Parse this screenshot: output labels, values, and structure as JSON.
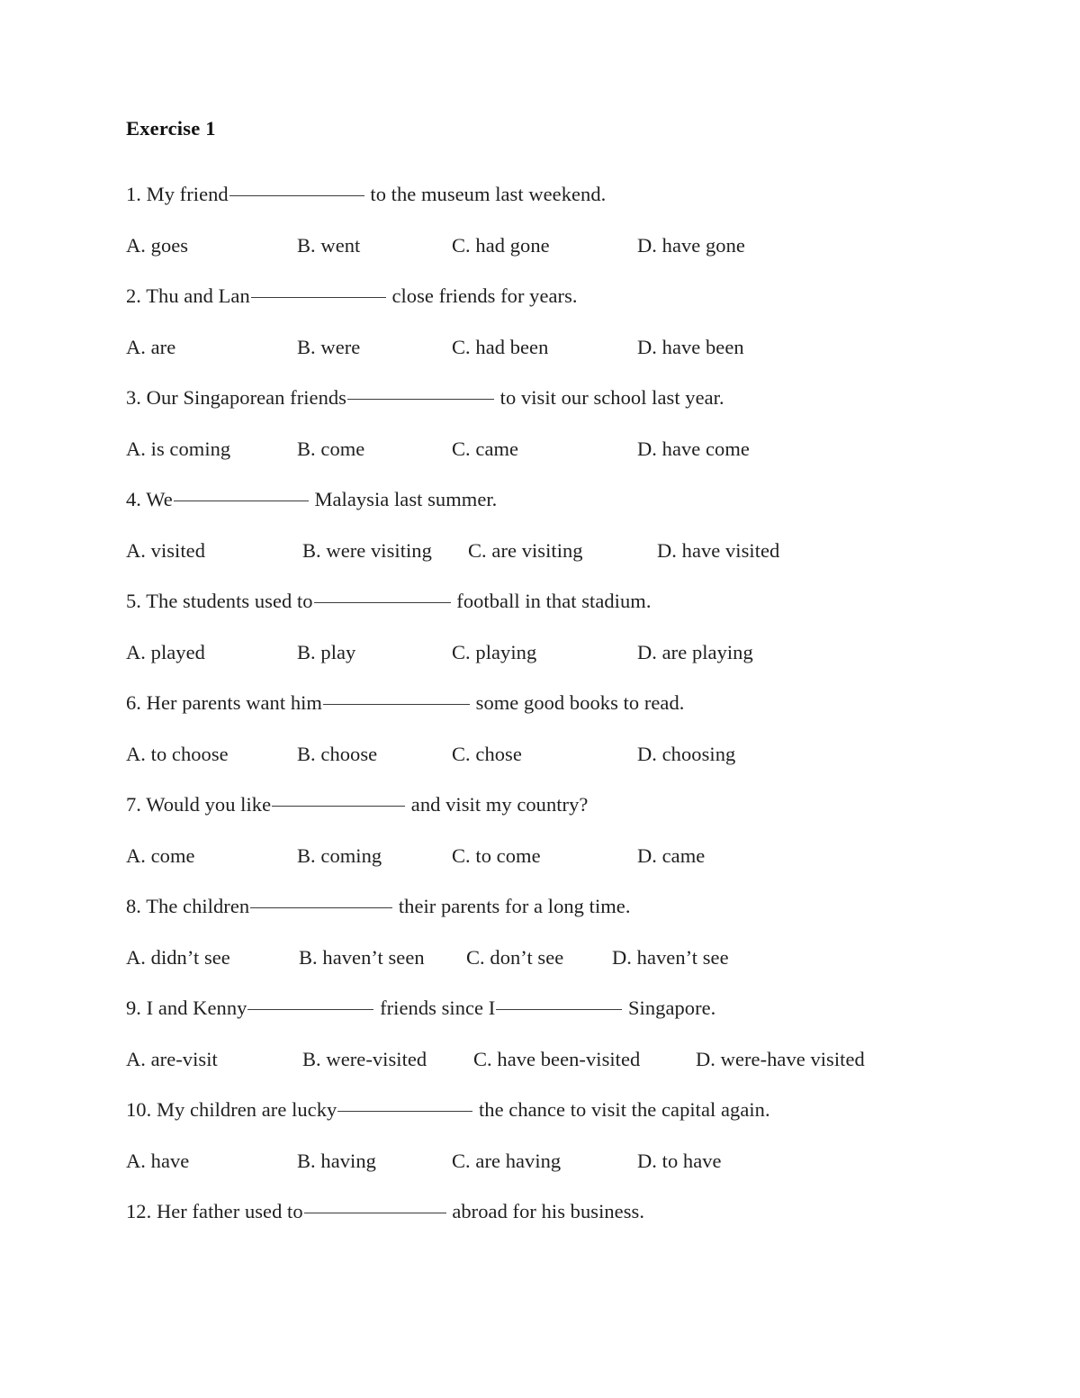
{
  "document": {
    "title": "Exercise 1",
    "items": [
      {
        "type": "question",
        "number": "1.",
        "text_before": "1. My friend",
        "blank_1_width": 150,
        "text_after": " to the museum last weekend.",
        "full_text": "1. My friend_____________ to the museum last weekend."
      },
      {
        "type": "options",
        "layout": "standard",
        "a": "A. goes",
        "b": "B. went",
        "c": "C. had gone",
        "d": "D. have gone"
      },
      {
        "type": "question",
        "number": "2.",
        "text_before": "2. Thu and Lan",
        "blank_1_width": 150,
        "text_after": " close friends for years.",
        "full_text": "2. Thu and Lan_____________ close friends for years."
      },
      {
        "type": "options",
        "layout": "standard",
        "a": "A. are",
        "b": "B. were",
        "c": "C. had been",
        "d": "D. have been"
      },
      {
        "type": "question",
        "number": "3.",
        "text_before": "3. Our Singaporean friends",
        "blank_1_width": 163,
        "text_after": " to visit our school last year.",
        "full_text": "3. Our Singaporean friends_______________ to visit our school last year."
      },
      {
        "type": "options",
        "layout": "standard",
        "a": "A. is coming",
        "b": "B. come",
        "c": "C. came",
        "d": "D. have come"
      },
      {
        "type": "question",
        "number": "4.",
        "text_before": "4. We",
        "blank_1_width": 150,
        "text_after": " Malaysia last summer.",
        "full_text": "4. We_____________ Malaysia last summer."
      },
      {
        "type": "options",
        "layout": "wide",
        "a": "A. visited",
        "b": "B. were visiting",
        "c": "C. are visiting",
        "d": "D. have visited"
      },
      {
        "type": "question",
        "number": "5.",
        "text_before": "5. The students used to",
        "blank_1_width": 152,
        "text_after": " football in that stadium.",
        "full_text": "5. The students used to______________ football in that stadium."
      },
      {
        "type": "options",
        "layout": "standard",
        "a": "A. played",
        "b": "B. play",
        "c": "C. playing",
        "d": "D. are playing"
      },
      {
        "type": "question",
        "number": "6.",
        "text_before": "6. Her parents want him",
        "blank_1_width": 163,
        "text_after": " some good books to read.",
        "full_text": "6. Her parents want him_______________ some good books to read."
      },
      {
        "type": "options",
        "layout": "standard",
        "a": "A. to choose",
        "b": "B. choose",
        "c": "C. chose",
        "d": "D. choosing"
      },
      {
        "type": "question",
        "number": "7.",
        "text_before": "7. Would you like",
        "blank_1_width": 148,
        "text_after": " and visit my country?",
        "full_text": "7. Would you like_____________ and visit my country?"
      },
      {
        "type": "options",
        "layout": "standard",
        "a": "A. come",
        "b": "B. coming",
        "c": "C. to come",
        "d": "D. came"
      },
      {
        "type": "question",
        "number": "8.",
        "text_before": "8. The children",
        "blank_1_width": 158,
        "text_after": " their parents for a long time.",
        "full_text": "8. The children______________ their parents for a long time."
      },
      {
        "type": "options",
        "layout": "narrow",
        "a": "A. didn’t see",
        "b": "B. haven’t seen",
        "c": "C. don’t see",
        "d": "D. haven’t see"
      },
      {
        "type": "question-two-blanks",
        "number": "9.",
        "text_before": "9. I and Kenny",
        "blank_1_width": 140,
        "text_middle": " friends since I",
        "blank_2_width": 140,
        "text_after": " Singapore.",
        "full_text": "9. I and Kenny____________ friends since I____________ Singapore."
      },
      {
        "type": "options",
        "layout": "widest",
        "a": "A. are-visit",
        "b": "B. were-visited",
        "c": "C. have been-visited",
        "d": "D. were-have visited"
      },
      {
        "type": "question",
        "number": "10.",
        "text_before": "10. My children are lucky",
        "blank_1_width": 150,
        "text_after": " the chance to visit the capital again.",
        "full_text": "10. My children are lucky_____________ the chance to visit the capital again."
      },
      {
        "type": "options",
        "layout": "standard",
        "a": "A. have",
        "b": "B. having",
        "c": "C. are having",
        "d": "D. to have"
      },
      {
        "type": "question",
        "number": "12.",
        "text_before": "12. Her father used to",
        "blank_1_width": 158,
        "text_after": " abroad for his business.",
        "full_text": "12. Her father used to______________ abroad for his business."
      }
    ]
  }
}
